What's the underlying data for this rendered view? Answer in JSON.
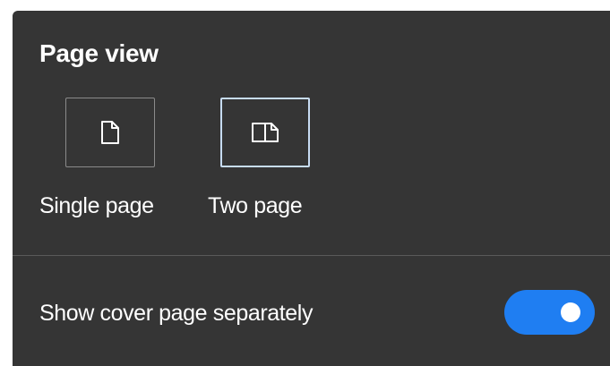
{
  "page_view": {
    "title": "Page view",
    "options": [
      {
        "label": "Single page",
        "icon": "single-page-icon",
        "selected": false
      },
      {
        "label": "Two page",
        "icon": "two-page-icon",
        "selected": true
      }
    ]
  },
  "cover_setting": {
    "label": "Show cover page separately",
    "enabled": true
  },
  "colors": {
    "panel_background": "#353535",
    "toggle_on": "#1f7ef2",
    "selected_border": "#c7dcf3"
  }
}
